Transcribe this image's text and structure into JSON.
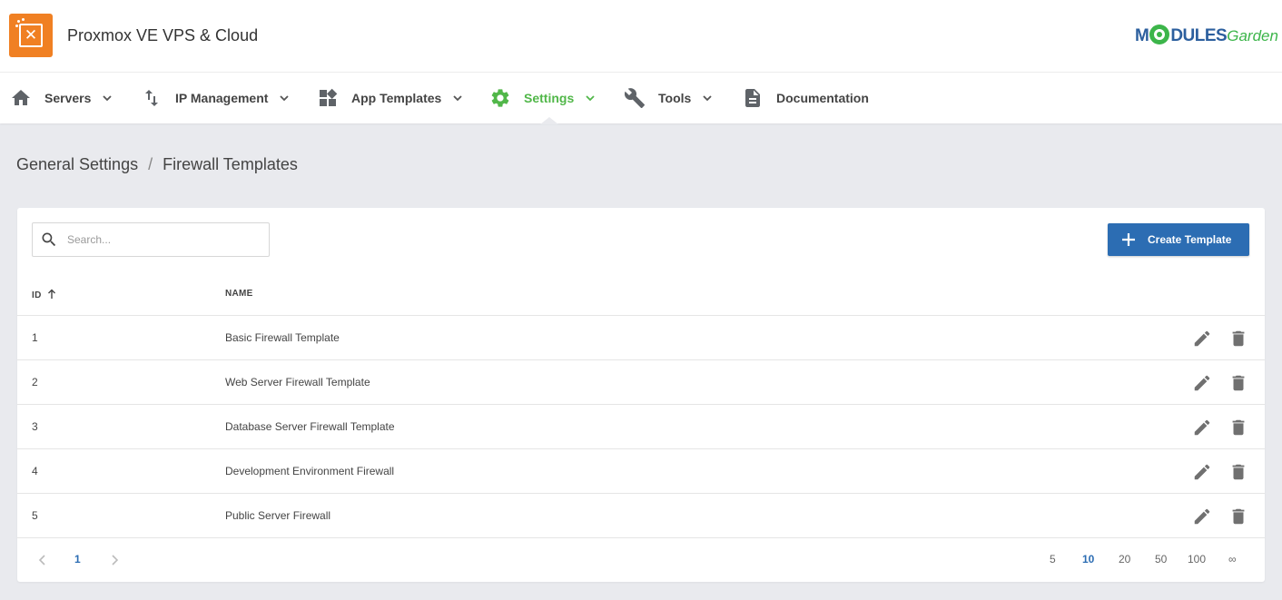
{
  "app": {
    "title": "Proxmox VE VPS & Cloud",
    "logo_icon": "proxmox-logo-icon"
  },
  "brand": {
    "part1": "M",
    "part2": "DULES",
    "part3": "Garden"
  },
  "colors": {
    "accent": "#51b749",
    "primary": "#2c6db3",
    "logo_bg": "#f08023"
  },
  "nav": {
    "items": [
      {
        "label": "Servers",
        "icon": "home-icon",
        "has_dropdown": true
      },
      {
        "label": "IP Management",
        "icon": "swap-vertical-icon",
        "has_dropdown": true
      },
      {
        "label": "App Templates",
        "icon": "widgets-icon",
        "has_dropdown": true
      },
      {
        "label": "Settings",
        "icon": "gear-icon",
        "has_dropdown": true,
        "active": true
      },
      {
        "label": "Tools",
        "icon": "wrench-icon",
        "has_dropdown": true
      },
      {
        "label": "Documentation",
        "icon": "document-icon",
        "has_dropdown": false
      }
    ]
  },
  "breadcrumb": {
    "parent": "General Settings",
    "separator": "/",
    "current": "Firewall Templates"
  },
  "search": {
    "placeholder": "Search...",
    "value": ""
  },
  "toolbar": {
    "create_label": "Create Template"
  },
  "table": {
    "columns": {
      "id": "ID",
      "name": "NAME"
    },
    "sort": {
      "column": "ID",
      "direction": "ascending"
    },
    "rows": [
      {
        "id": "1",
        "name": "Basic Firewall Template"
      },
      {
        "id": "2",
        "name": "Web Server Firewall Template"
      },
      {
        "id": "3",
        "name": "Database Server Firewall Template"
      },
      {
        "id": "4",
        "name": "Development Environment Firewall"
      },
      {
        "id": "5",
        "name": "Public Server Firewall"
      }
    ]
  },
  "pagination": {
    "current_page": "1",
    "page_sizes": [
      "5",
      "10",
      "20",
      "50",
      "100",
      "∞"
    ],
    "selected_size": "10"
  }
}
